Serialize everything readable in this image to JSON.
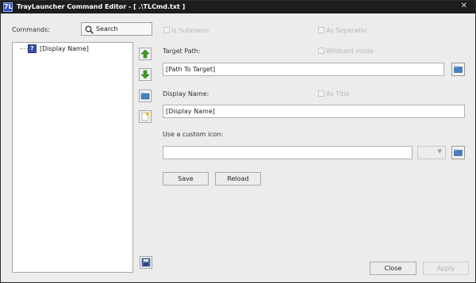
{
  "window": {
    "title": "TrayLauncher Command Editor  -  [ .\\TLCmd.txt ]",
    "app_icon_glyph": "7L",
    "close_glyph": "✕"
  },
  "commands": {
    "label": "Commands:",
    "search_label": "Search",
    "tree_items": [
      {
        "label": "[Display Name]",
        "icon": "command-icon",
        "icon_glyph": "?"
      }
    ]
  },
  "options": {
    "is_submenu": "Is Submenu",
    "as_separator": "As Separator",
    "wildcard_mode": "Wildcard mode",
    "as_title": "As Title"
  },
  "form": {
    "target_path_label": "Target Path:",
    "target_path_value": "[Path To Target]",
    "display_name_label": "Display Name:",
    "display_name_value": "[Display Name]",
    "custom_icon_label": "Use a custom icon:",
    "custom_icon_value": "",
    "dropdown_arrow": "▼"
  },
  "buttons": {
    "save": "Save",
    "reload": "Reload",
    "close": "Close",
    "apply": "Apply"
  },
  "icons": {
    "move_up": "arrow-up-icon",
    "move_down": "arrow-down-icon",
    "new_folder": "folder-icon",
    "new_item": "new-file-icon",
    "save_file": "save-icon",
    "browse": "folder-open-icon"
  },
  "colors": {
    "titlebar": "#1d1d1d",
    "window_bg": "#ececec",
    "arrow_green": "#3e9e24",
    "folder_blue": "#4a7fc0"
  }
}
